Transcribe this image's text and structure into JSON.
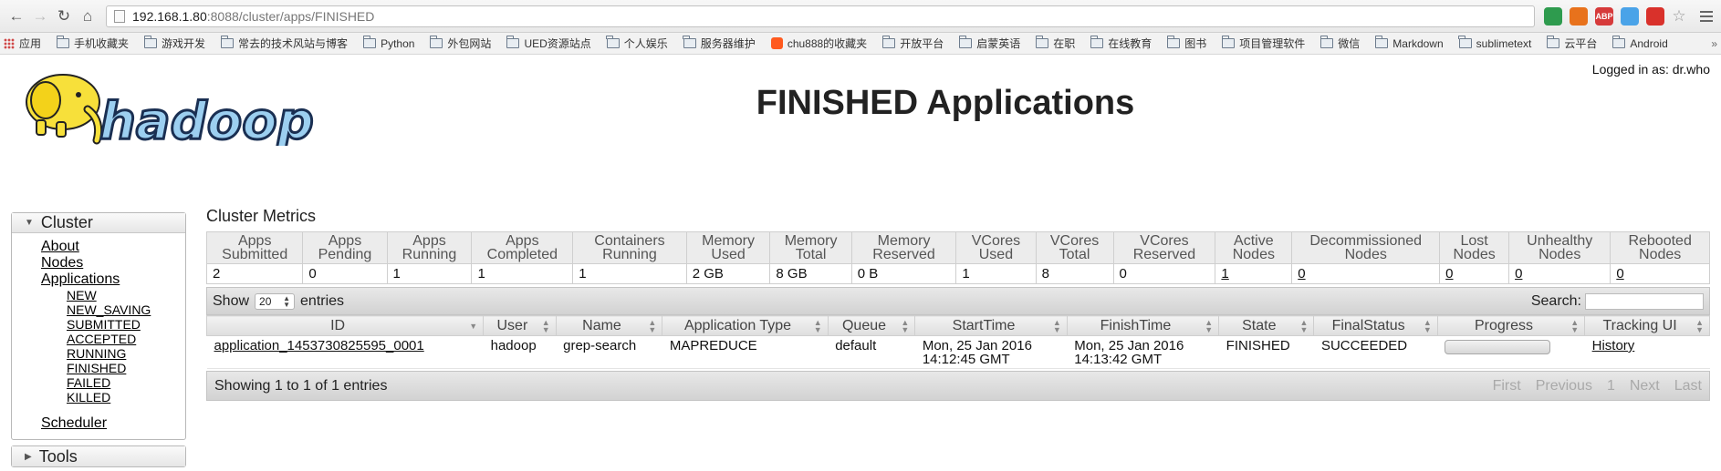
{
  "browser": {
    "url_host": "192.168.1.80",
    "url_path": ":8088/cluster/apps/FINISHED",
    "extensions": [
      {
        "name": "shield-extension-icon",
        "color": "#2e9b4e",
        "label": ""
      },
      {
        "name": "infinity-extension-icon",
        "color": "#e8721c",
        "label": ""
      },
      {
        "name": "adblock-extension-icon",
        "color": "#d63a3a",
        "label": "ABP"
      },
      {
        "name": "share-extension-icon",
        "color": "#4aa3e8",
        "label": ""
      },
      {
        "name": "opera-extension-icon",
        "color": "#d9312b",
        "label": ""
      }
    ]
  },
  "bookmarks": [
    {
      "label": "应用",
      "icon": "apps-grid-icon"
    },
    {
      "label": "手机收藏夹",
      "icon": "folder-icon"
    },
    {
      "label": "游戏开发",
      "icon": "folder-icon"
    },
    {
      "label": "常去的技术风站与博客",
      "icon": "folder-icon"
    },
    {
      "label": "Python",
      "icon": "folder-icon"
    },
    {
      "label": "外包网站",
      "icon": "folder-icon"
    },
    {
      "label": "UED资源站点",
      "icon": "folder-icon"
    },
    {
      "label": "个人娱乐",
      "icon": "folder-icon"
    },
    {
      "label": "服务器维护",
      "icon": "folder-icon"
    },
    {
      "label": "chu888的收藏夹",
      "icon": "taobao-icon"
    },
    {
      "label": "开放平台",
      "icon": "folder-icon"
    },
    {
      "label": "启蒙英语",
      "icon": "folder-icon"
    },
    {
      "label": "在职",
      "icon": "folder-icon"
    },
    {
      "label": "在线教育",
      "icon": "folder-icon"
    },
    {
      "label": "图书",
      "icon": "folder-icon"
    },
    {
      "label": "项目管理软件",
      "icon": "folder-icon"
    },
    {
      "label": "微信",
      "icon": "folder-icon"
    },
    {
      "label": "Markdown",
      "icon": "folder-icon"
    },
    {
      "label": "sublimetext",
      "icon": "folder-icon"
    },
    {
      "label": "云平台",
      "icon": "folder-icon"
    },
    {
      "label": "Android",
      "icon": "folder-icon"
    }
  ],
  "header": {
    "title": "FINISHED Applications",
    "logged_in": "Logged in as: dr.who",
    "logo_text": "hadoop"
  },
  "sidebar": {
    "cluster_label": "Cluster",
    "links": [
      "About",
      "Nodes",
      "Applications"
    ],
    "states": [
      "NEW",
      "NEW_SAVING",
      "SUBMITTED",
      "ACCEPTED",
      "RUNNING",
      "FINISHED",
      "FAILED",
      "KILLED"
    ],
    "scheduler": "Scheduler",
    "tools_label": "Tools"
  },
  "metrics": {
    "title": "Cluster Metrics",
    "headers": [
      "Apps Submitted",
      "Apps Pending",
      "Apps Running",
      "Apps Completed",
      "Containers Running",
      "Memory Used",
      "Memory Total",
      "Memory Reserved",
      "VCores Used",
      "VCores Total",
      "VCores Reserved",
      "Active Nodes",
      "Decommissioned Nodes",
      "Lost Nodes",
      "Unhealthy Nodes",
      "Rebooted Nodes"
    ],
    "values": [
      "2",
      "0",
      "1",
      "1",
      "1",
      "2 GB",
      "8 GB",
      "0 B",
      "1",
      "8",
      "0",
      "1",
      "0",
      "0",
      "0",
      "0"
    ],
    "linked": [
      false,
      false,
      false,
      false,
      false,
      false,
      false,
      false,
      false,
      false,
      false,
      true,
      true,
      true,
      true,
      true
    ]
  },
  "table_controls": {
    "show_label": "Show",
    "page_size": "20",
    "entries_label": "entries",
    "search_label": "Search:",
    "search_value": ""
  },
  "apps_table": {
    "headers": [
      "ID",
      "User",
      "Name",
      "Application Type",
      "Queue",
      "StartTime",
      "FinishTime",
      "State",
      "FinalStatus",
      "Progress",
      "Tracking UI"
    ],
    "rows": [
      {
        "id": "application_1453730825595_0001",
        "user": "hadoop",
        "name": "grep-search",
        "type": "MAPREDUCE",
        "queue": "default",
        "start_date": "Mon, 25 Jan 2016",
        "start_time": "14:12:45 GMT",
        "finish_date": "Mon, 25 Jan 2016",
        "finish_time": "14:13:42 GMT",
        "state": "FINISHED",
        "final_status": "SUCCEEDED",
        "progress": 0,
        "tracking": "History"
      }
    ]
  },
  "footer": {
    "info": "Showing 1 to 1 of 1 entries",
    "pager": [
      "First",
      "Previous",
      "1",
      "Next",
      "Last"
    ]
  }
}
